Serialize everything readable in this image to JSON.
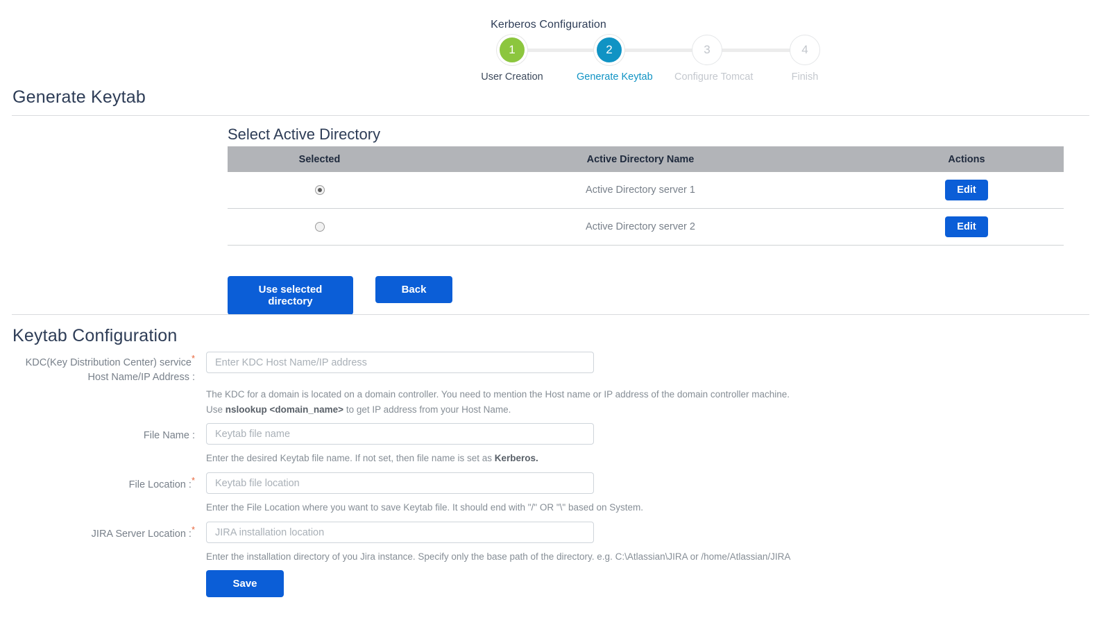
{
  "wizard": {
    "title": "Kerberos Configuration",
    "steps": [
      {
        "number": "1",
        "label": "User Creation",
        "state": "done"
      },
      {
        "number": "2",
        "label": "Generate Keytab",
        "state": "active"
      },
      {
        "number": "3",
        "label": "Configure Tomcat",
        "state": "todo"
      },
      {
        "number": "4",
        "label": "Finish",
        "state": "todo"
      }
    ],
    "colors": {
      "done": "#8cc63e",
      "active": "#1093c4",
      "todo_text": "#c4c8ce",
      "connector": "#ececec"
    }
  },
  "page": {
    "heading": "Generate Keytab"
  },
  "directory_section": {
    "title": "Select Active Directory",
    "table": {
      "headers": [
        "Selected",
        "Active Directory Name",
        "Actions"
      ],
      "rows": [
        {
          "selected": true,
          "name": "Active Directory server 1",
          "action_label": "Edit"
        },
        {
          "selected": false,
          "name": "Active Directory server 2",
          "action_label": "Edit"
        }
      ]
    },
    "buttons": {
      "use_selected": "Use selected directory",
      "back": "Back"
    },
    "colors": {
      "header_bg": "#b2b4b8",
      "button_blue": "#0b5ed7"
    }
  },
  "keytab_section": {
    "heading": "Keytab Configuration",
    "fields": [
      {
        "label": "KDC(Key Distribution Center) service Host Name/IP Address :",
        "label_line1": "KDC(Key Distribution Center) service",
        "label_line2": "Host Name/IP Address :",
        "required": true,
        "value": "",
        "placeholder": "Enter KDC Host Name/IP address",
        "help_line1": "The KDC for a domain is located on a domain controller. You need to mention the Host name or IP address of the domain controller machine.",
        "help_line2_pre": "Use ",
        "help_line2_bold": "nslookup <domain_name>",
        "help_line2_post": " to get IP address from your Host Name."
      },
      {
        "label": "File Name :",
        "required": false,
        "value": "",
        "placeholder": "Keytab file name",
        "help_pre": "Enter the desired Keytab file name. If not set, then file name is set as ",
        "help_bold": "Kerberos.",
        "help_post": ""
      },
      {
        "label": "File Location :",
        "required": true,
        "value": "",
        "placeholder": "Keytab file location",
        "help": "Enter the File Location where you want to save Keytab file. It should end with \"/\" OR \"\\\" based on System."
      },
      {
        "label": "JIRA Server Location :",
        "required": true,
        "value": "",
        "placeholder": "JIRA installation location",
        "help": "Enter the installation directory of you Jira instance. Specify only the base path of the directory. e.g. C:\\Atlassian\\JIRA or /home/Atlassian/JIRA"
      }
    ],
    "save_label": "Save"
  }
}
